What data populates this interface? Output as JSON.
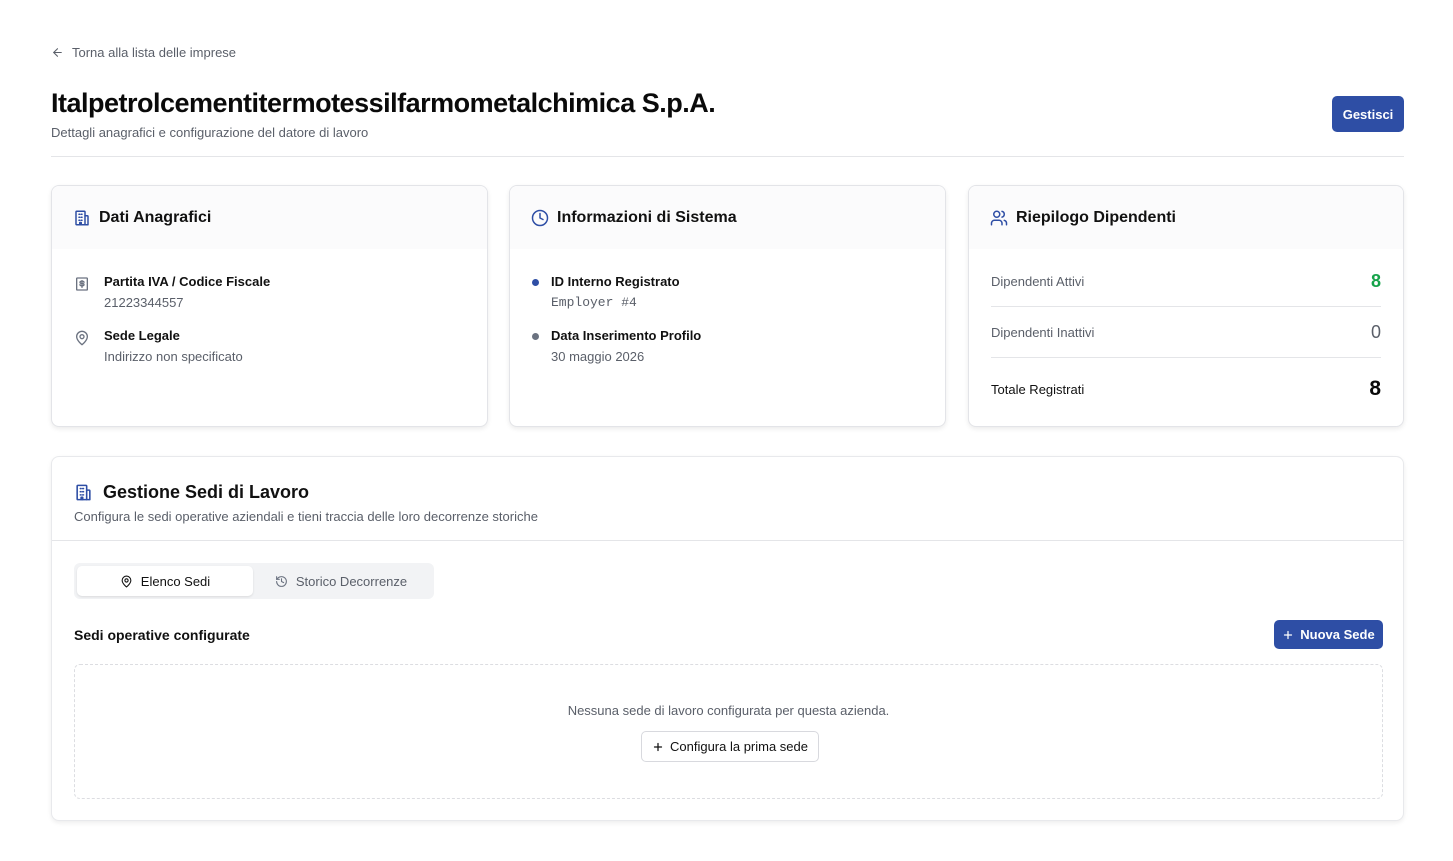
{
  "header": {
    "back_link": "Torna alla lista delle imprese",
    "title": "Italpetrolcementitermotessilfarmometalchimica S.p.A.",
    "subtitle": "Dettagli anagrafici e configurazione del datore di lavoro",
    "manage_button": "Gestisci"
  },
  "cards": {
    "anagrafica": {
      "title": "Dati Anagrafici",
      "vat_label": "Partita IVA / Codice Fiscale",
      "vat_value": "21223344557",
      "address_label": "Sede Legale",
      "address_value": "Indirizzo non specificato"
    },
    "system": {
      "title": "Informazioni di Sistema",
      "id_label": "ID Interno Registrato",
      "id_value": "Employer #4",
      "date_label": "Data Inserimento Profilo",
      "date_value": "30 maggio 2026"
    },
    "employees": {
      "title": "Riepilogo Dipendenti",
      "active_label": "Dipendenti Attivi",
      "active_value": "8",
      "inactive_label": "Dipendenti Inattivi",
      "inactive_value": "0",
      "total_label": "Totale Registrati",
      "total_value": "8"
    }
  },
  "locations": {
    "title": "Gestione Sedi di Lavoro",
    "subtitle": "Configura le sedi operative aziendali e tieni traccia delle loro decorrenze storiche",
    "tabs": [
      {
        "label": "Elenco Sedi"
      },
      {
        "label": "Storico Decorrenze"
      }
    ],
    "list_heading": "Sedi operative configurate",
    "new_button": "Nuova Sede",
    "empty_text": "Nessuna sede di lavoro configurata per questa azienda.",
    "first_button": "Configura la prima sede"
  },
  "colors": {
    "primary": "#2e4ea5",
    "active_green": "#16a34a",
    "dot_blue": "#2e4ea5",
    "dot_gray": "#6b7280"
  },
  "icons": {
    "back": "arrow-left-icon",
    "building": "building-icon",
    "clock": "clock-icon",
    "users": "users-icon",
    "receipt": "receipt-icon",
    "map_pin": "map-pin-icon",
    "history": "history-icon",
    "plus": "plus-icon"
  }
}
